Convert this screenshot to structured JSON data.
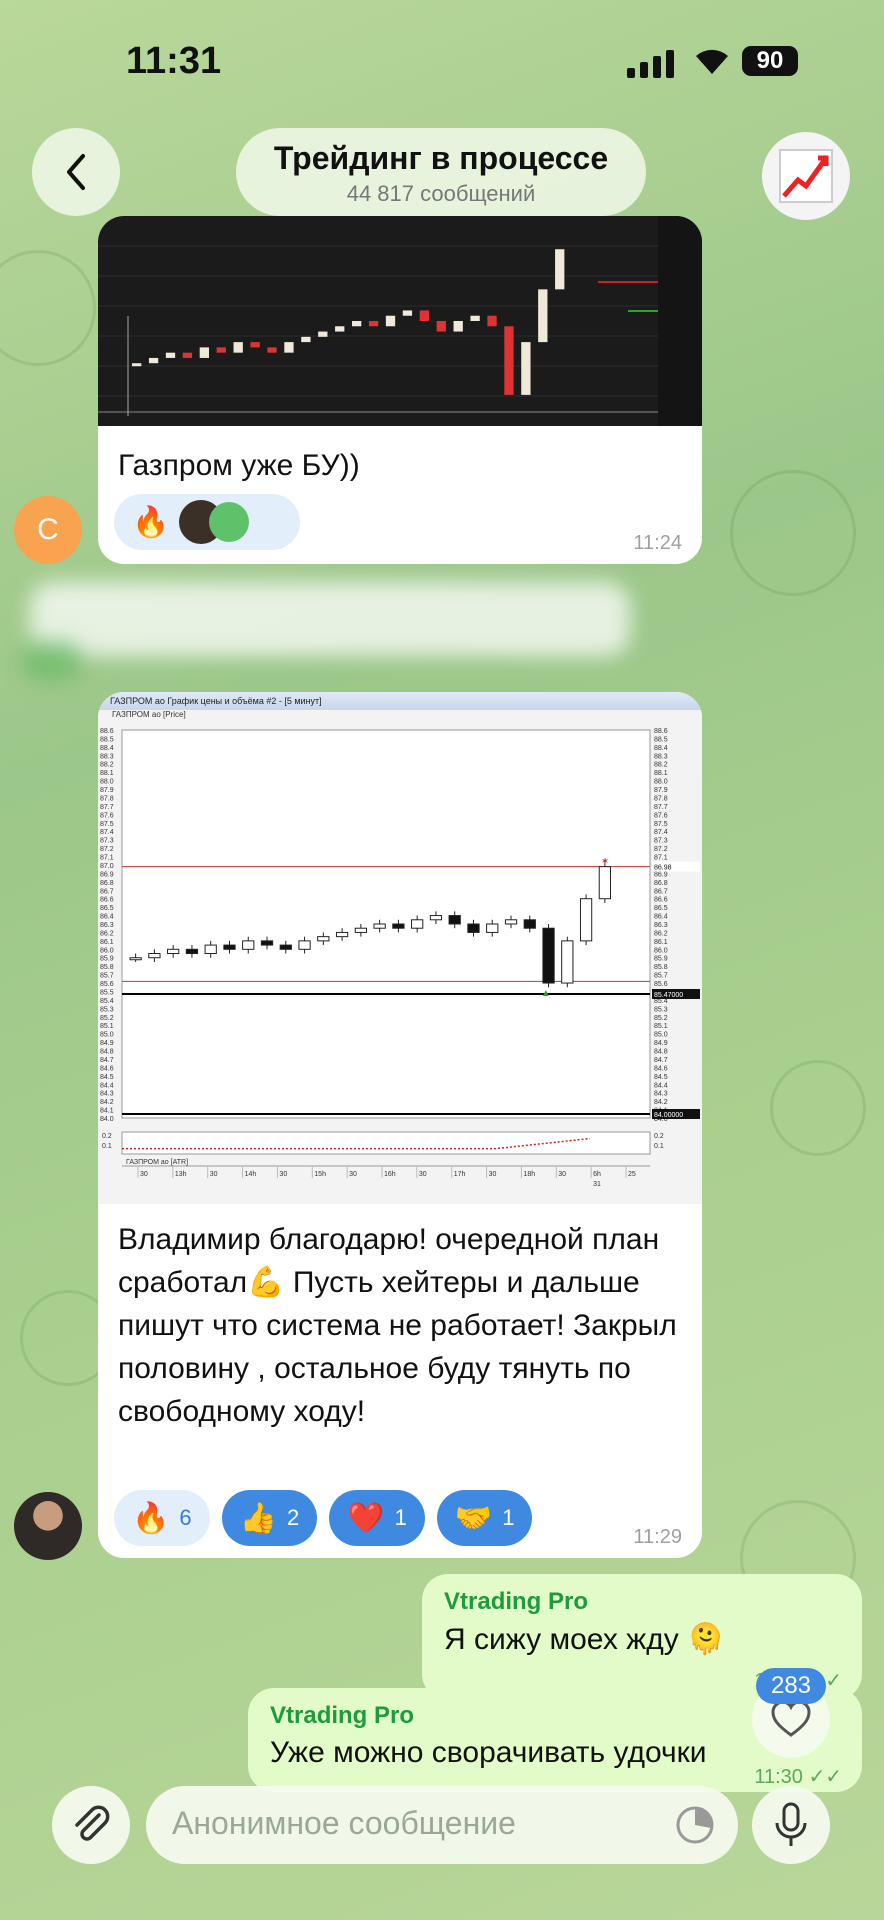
{
  "status_bar": {
    "time": "11:31",
    "battery": "90"
  },
  "header": {
    "title": "Трейдинг в процессе",
    "subtitle": "44 817 сообщений"
  },
  "messages": [
    {
      "avatar_letter": "C",
      "text": "Газпром уже БУ))",
      "reactions": [
        {
          "emoji": "🔥"
        }
      ],
      "time": "11:24"
    },
    {
      "chart_title": "ГАЗПРОМ ао График цены и объёма #2 - [5 минут]",
      "chart_series": "ГАЗПРОМ ао [Price]",
      "chart_indicator": "ГАЗПРОМ ао [ATR]",
      "text": "Владимир благодарю! очередной план сработал💪 Пусть хейтеры и дальше пишут что система не работает! Закрыл половину , остальное буду тянуть по свободному ходу!",
      "reactions": [
        {
          "emoji": "🔥",
          "count": "6"
        },
        {
          "emoji": "👍",
          "count": "2"
        },
        {
          "emoji": "❤️",
          "count": "1"
        },
        {
          "emoji": "🤝",
          "count": "1"
        }
      ],
      "time": "11:29"
    }
  ],
  "own_messages": [
    {
      "sender": "Vtrading Pro",
      "text": "Я сижу моех жду 🫠",
      "time": "11:30 ✓✓"
    },
    {
      "sender": "Vtrading Pro",
      "text": "Уже можно сворачивать удочки",
      "time": "11:30 ✓✓"
    }
  ],
  "unread_count": "283",
  "composer": {
    "placeholder": "Анонимное сообщение"
  },
  "colors": {
    "accent": "#3f8ae0",
    "own_bubble": "#e2fbc8",
    "sender": "#1e9c3c"
  },
  "chart_data": {
    "type": "candlestick",
    "title": "ГАЗПРОМ ао График цены и объёма #2 - [5 минут]",
    "ylim": [
      84.0,
      88.6
    ],
    "y_ticks": [
      "88.6",
      "88.5",
      "88.4",
      "88.3",
      "88.2",
      "88.1",
      "88.0",
      "87.9",
      "87.8",
      "87.7",
      "87.6",
      "87.5",
      "87.4",
      "87.3",
      "87.2",
      "87.1",
      "87.0",
      "86.9",
      "86.8",
      "86.7",
      "86.6",
      "86.5",
      "86.4",
      "86.3",
      "86.2",
      "86.1",
      "86.0",
      "85.9",
      "85.8",
      "85.7",
      "85.6",
      "85.5",
      "85.4",
      "85.3",
      "85.2",
      "85.1",
      "85.0",
      "84.9",
      "84.8",
      "84.7",
      "84.6",
      "84.5",
      "84.4",
      "84.3",
      "84.2",
      "84.1",
      "84.0"
    ],
    "price_labels": [
      "86.98",
      "85.47000",
      "84.00000"
    ],
    "x_ticks": [
      "30",
      "13h",
      "30",
      "14h",
      "30",
      "15h",
      "30",
      "16h",
      "30",
      "17h",
      "30",
      "18h",
      "30",
      "6h",
      "25"
    ],
    "x_subticks": [
      "31"
    ],
    "atr_ticks": [
      "0.2",
      "0.1"
    ],
    "close_approx": [
      85.9,
      85.95,
      86.0,
      85.95,
      86.05,
      86.0,
      86.1,
      86.05,
      86.0,
      86.1,
      86.15,
      86.2,
      86.25,
      86.3,
      86.25,
      86.35,
      86.4,
      86.3,
      86.2,
      86.3,
      86.35,
      86.25,
      85.6,
      86.1,
      86.6,
      86.98
    ]
  }
}
